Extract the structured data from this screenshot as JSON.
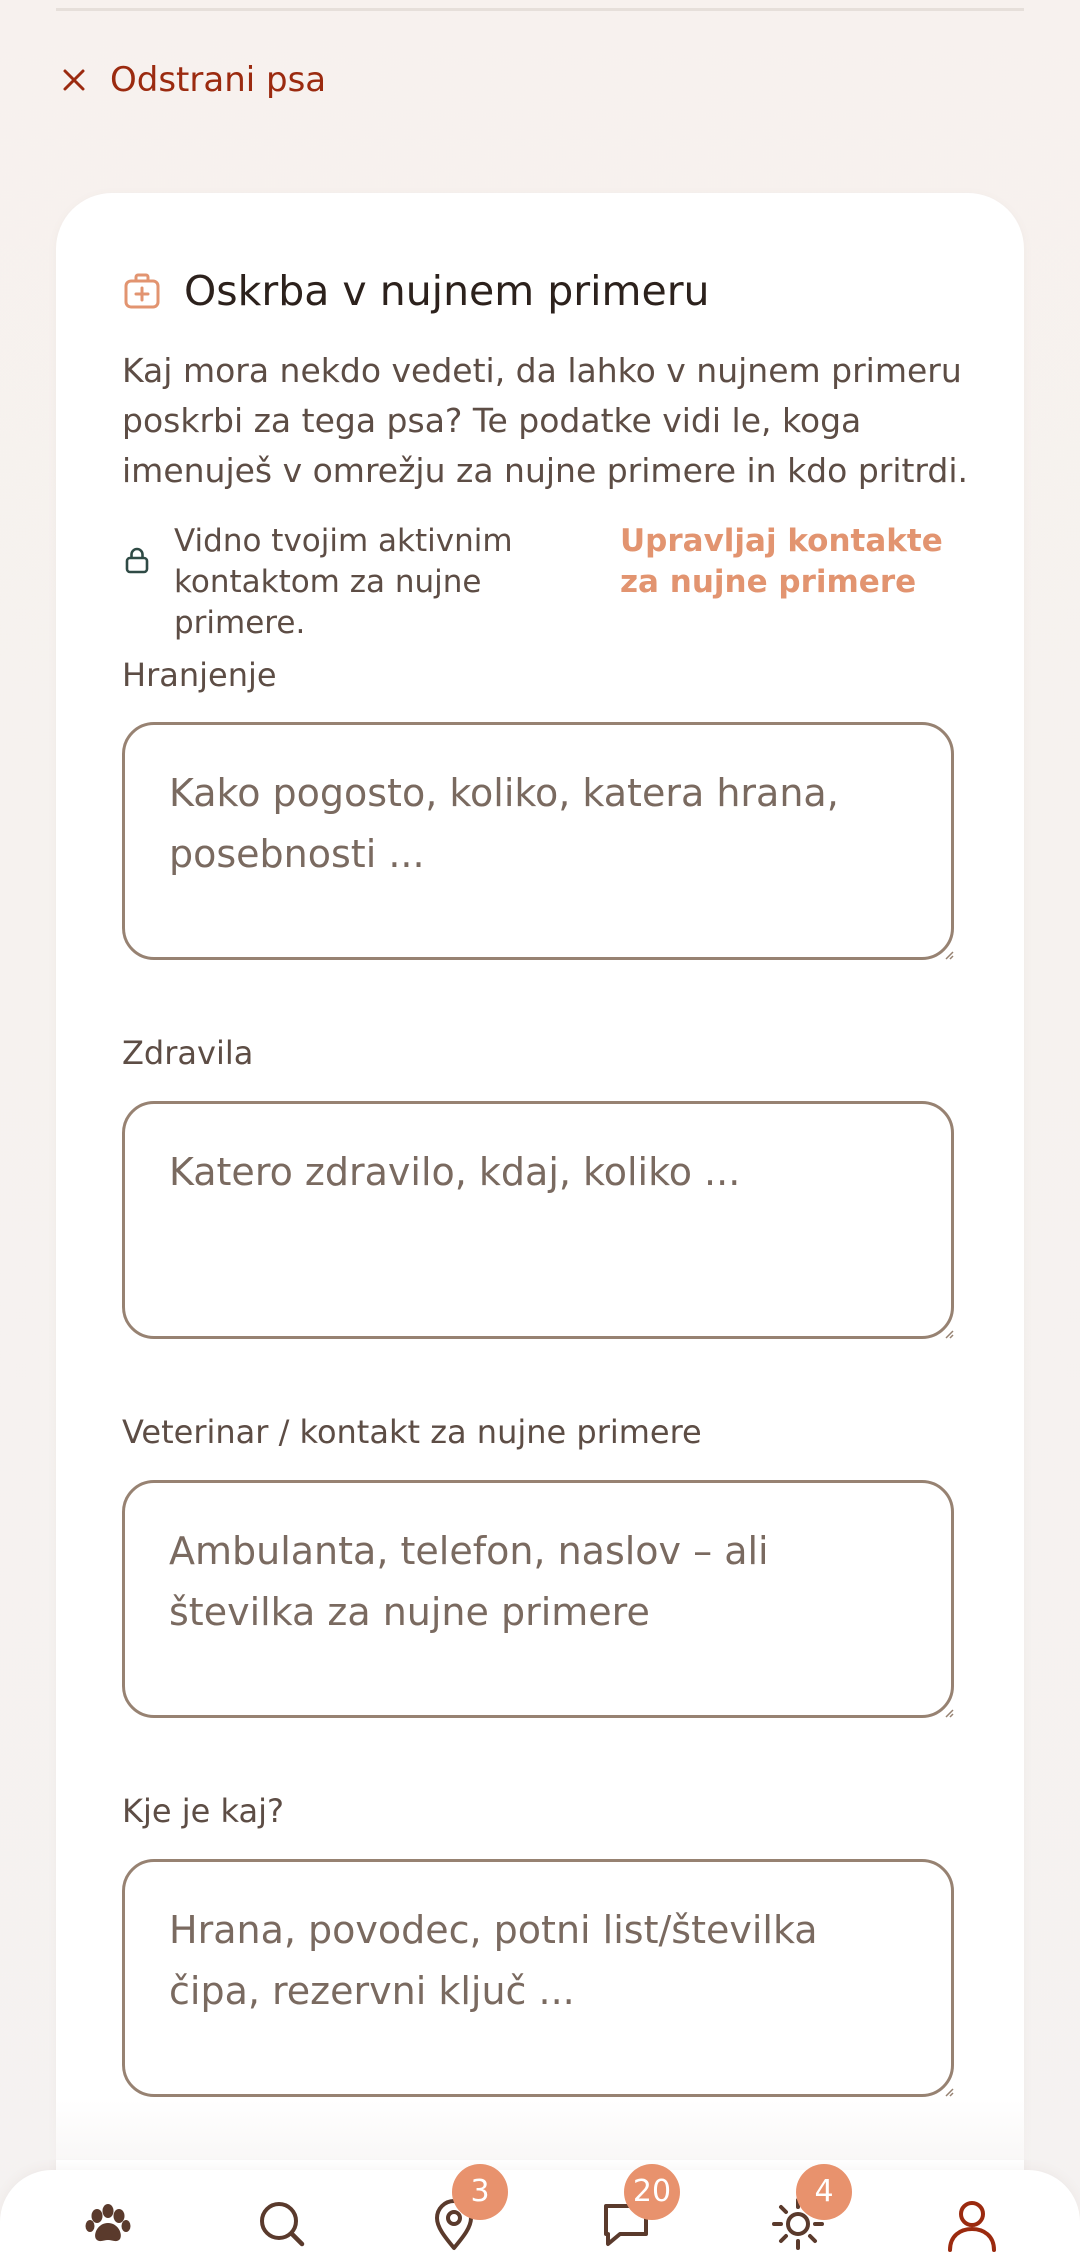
{
  "colors": {
    "accent": "#e29470",
    "danger": "#9b2a0f",
    "badge": "#e8926d",
    "text": "#2c211c",
    "muted_text": "#5d4d45",
    "field_border": "#978272",
    "icon_brown": "#5a3a2c"
  },
  "remove_dog": {
    "icon": "close-icon",
    "label": "Odstrani psa"
  },
  "emergency_care": {
    "icon": "first-aid-kit-icon",
    "title": "Oskrba v nujnem primeru",
    "description": "Kaj mora nekdo vedeti, da lahko v nujnem primeru poskrbi za tega psa? Te podatke vidi le, koga imenuješ v omrežju za nujne primere in kdo pritrdi.",
    "privacy_icon": "lock-icon",
    "privacy_note": "Vidno tvojim aktivnim kontaktom za nujne primere.",
    "manage_link": "Upravljaj kontakte za nujne primere"
  },
  "fields": [
    {
      "label": "Hranjenje",
      "placeholder": "Kako pogosto, koliko, katera hrana, posebnosti ..."
    },
    {
      "label": "Zdravila",
      "placeholder": "Katero zdravilo, kdaj, koliko ..."
    },
    {
      "label": "Veterinar / kontakt za nujne primere",
      "placeholder": "Ambulanta, telefon, naslov – ali številka za nujne primere"
    },
    {
      "label": "Kje je kaj?",
      "placeholder": "Hrana, povodec, potni list/številka čipa, rezervni ključ ..."
    }
  ],
  "tabbar": {
    "tabs": [
      {
        "icon": "paw-icon",
        "badge": ""
      },
      {
        "icon": "search-icon",
        "badge": ""
      },
      {
        "icon": "map-pin-icon",
        "badge": "3"
      },
      {
        "icon": "chat-icon",
        "badge": "20"
      },
      {
        "icon": "sun-icon",
        "badge": "4"
      },
      {
        "icon": "profile-icon",
        "badge": ""
      }
    ]
  }
}
